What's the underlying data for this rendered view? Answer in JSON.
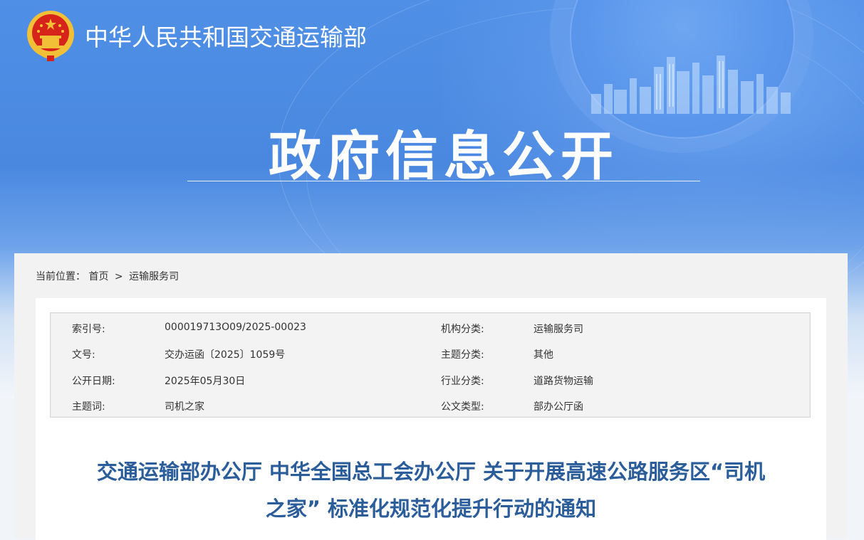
{
  "header": {
    "ministry_name": "中华人民共和国交通运输部",
    "emblem_icon": "national-emblem-icon",
    "section_title": "政府信息公开",
    "colors": {
      "banner_blue": "#4a88e0",
      "emblem_red": "#d6241a",
      "emblem_gold": "#f2c037",
      "title_blue": "#2a5d9a"
    }
  },
  "breadcrumb": {
    "label": "当前位置：",
    "home": "首页",
    "separator": ">",
    "current": "运输服务司"
  },
  "meta": {
    "rows": [
      {
        "label1": "索引号:",
        "value1": "000019713O09/2025-00023",
        "label2": "机构分类:",
        "value2": "运输服务司"
      },
      {
        "label1": "文号:",
        "value1": "交办运函〔2025〕1059号",
        "label2": "主题分类:",
        "value2": "其他"
      },
      {
        "label1": "公开日期:",
        "value1": "2025年05月30日",
        "label2": "行业分类:",
        "value2": "道路货物运输"
      },
      {
        "label1": "主题词:",
        "value1": "司机之家",
        "label2": "公文类型:",
        "value2": "部办公厅函"
      }
    ]
  },
  "document": {
    "title_line1": "交通运输部办公厅 中华全国总工会办公厅 关于开展高速公路服务区“司机",
    "title_line2": "之家” 标准化规范化提升行动的通知"
  }
}
